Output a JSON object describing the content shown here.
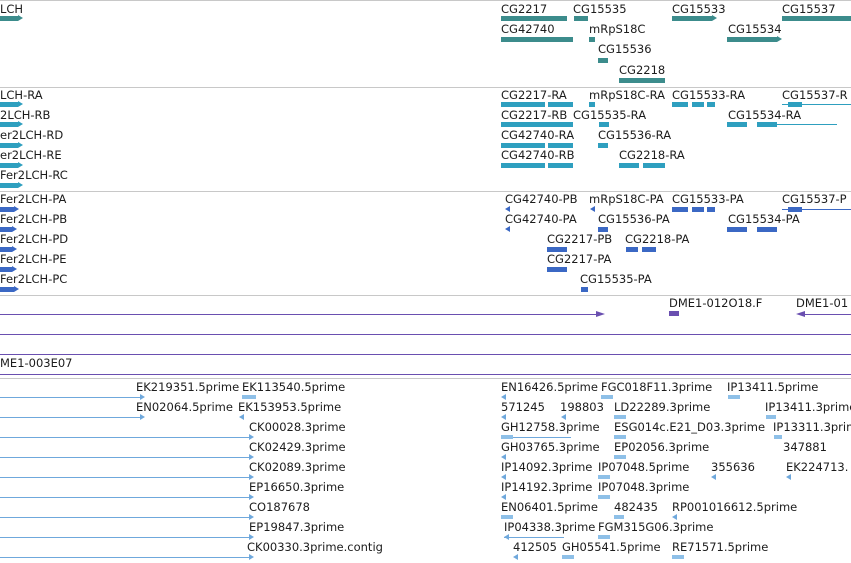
{
  "colors": {
    "gene": "#3c8c8c",
    "transcript": "#2e9fbf",
    "protein": "#3b68c4",
    "clone": "#6a4fb0",
    "est": "#6fa8dc",
    "separator": "#c8c8c8"
  },
  "tracks": {
    "genes": [
      "LCH",
      "CG2217",
      "CG15535",
      "CG15533",
      "CG15537",
      "CG42740",
      "mRpS18C",
      "CG15534",
      "CG15536",
      "CG2218"
    ],
    "transcripts": [
      "LCH-RA",
      "2LCH-RB",
      "er2LCH-RD",
      "er2LCH-RE",
      "Fer2LCH-RC",
      "CG2217-RA",
      "mRpS18C-RA",
      "CG15533-RA",
      "CG15537-R",
      "CG2217-RB",
      "CG15535-RA",
      "CG15534-RA",
      "CG42740-RA",
      "CG15536-RA",
      "CG42740-RB",
      "CG2218-RA"
    ],
    "proteins": [
      "Fer2LCH-PA",
      "Fer2LCH-PB",
      "Fer2LCH-PD",
      "Fer2LCH-PE",
      "Fer2LCH-PC",
      "CG42740-PB",
      "mRpS18C-PA",
      "CG15533-PA",
      "CG15537-P",
      "CG42740-PA",
      "CG15536-PA",
      "CG15534-PA",
      "CG2217-PB",
      "CG2218-PA",
      "CG2217-PA",
      "CG15535-PA"
    ],
    "clones": [
      "DME1-012O18.F",
      "DME1-01",
      "ME1-003E07"
    ],
    "ests": [
      "EK219351.5prime",
      "EK113540.5prime",
      "EN16426.5prime",
      "FGC018F11.3prime",
      "IP13411.5prime",
      "EN02064.5prime",
      "EK153953.5prime",
      "571245",
      "198803",
      "LD22289.3prime",
      "IP13411.3prime",
      "CK00028.3prime",
      "GH12758.3prime",
      "ESG014c.E21_D03.3prime",
      "IP13311.3prime",
      "CK02429.3prime",
      "GH03765.3prime",
      "EP02056.3prime",
      "347881",
      "CK02089.3prime",
      "IP14092.3prime",
      "IP07048.5prime",
      "355636",
      "EK224713.",
      "EP16650.3prime",
      "IP14192.3prime",
      "IP07048.3prime",
      "CO187678",
      "EN06401.5prime",
      "482435",
      "RP001016612.5prime",
      "EP19847.3prime",
      "IP04338.3prime",
      "FGM315G06.3prime",
      "CK00330.3prime.contig",
      "412505",
      "GH05541.5prime",
      "RE71571.5prime"
    ]
  }
}
